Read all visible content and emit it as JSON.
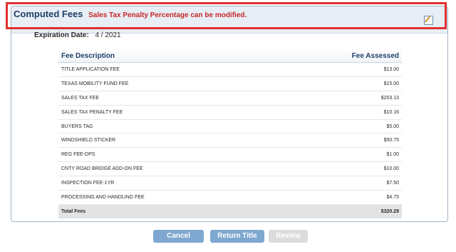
{
  "header": {
    "title": "Computed Fees",
    "notice": "Sales Tax Penalty Percentage can be modified."
  },
  "expiration": {
    "label": "Expiration Date:",
    "value": "4 / 2021"
  },
  "table": {
    "columns": [
      "Fee Description",
      "Fee Assessed"
    ],
    "rows": [
      {
        "description": "TITLE APPLICATION FEE",
        "amount": "$13.00"
      },
      {
        "description": "TEXAS MOBILITY FUND FEE",
        "amount": "$15.00"
      },
      {
        "description": "SALES TAX FEE",
        "amount": "$203.13"
      },
      {
        "description": "SALES TAX PENALTY FEE",
        "amount": "$10.16"
      },
      {
        "description": "BUYERS TAG",
        "amount": "$5.00"
      },
      {
        "description": "WINDSHIELD STICKER",
        "amount": "$50.75"
      },
      {
        "description": "REG FEE-DPS",
        "amount": "$1.00"
      },
      {
        "description": "CNTY ROAD BRIDGE ADD-ON FEE",
        "amount": "$10.00"
      },
      {
        "description": "INSPECTION FEE-1YR",
        "amount": "$7.50"
      },
      {
        "description": "PROCESSING AND HANDLING FEE",
        "amount": "$4.75"
      }
    ],
    "total": {
      "label": "Total Fees",
      "amount": "$320.29"
    }
  },
  "buttons": {
    "cancel": "Cancel",
    "return_title": "Return Title",
    "review": "Review"
  },
  "colors": {
    "title": "#1f3f6b",
    "notice": "#c62828",
    "button_primary": "#7fa8d0",
    "button_disabled": "#dcdcdc"
  }
}
